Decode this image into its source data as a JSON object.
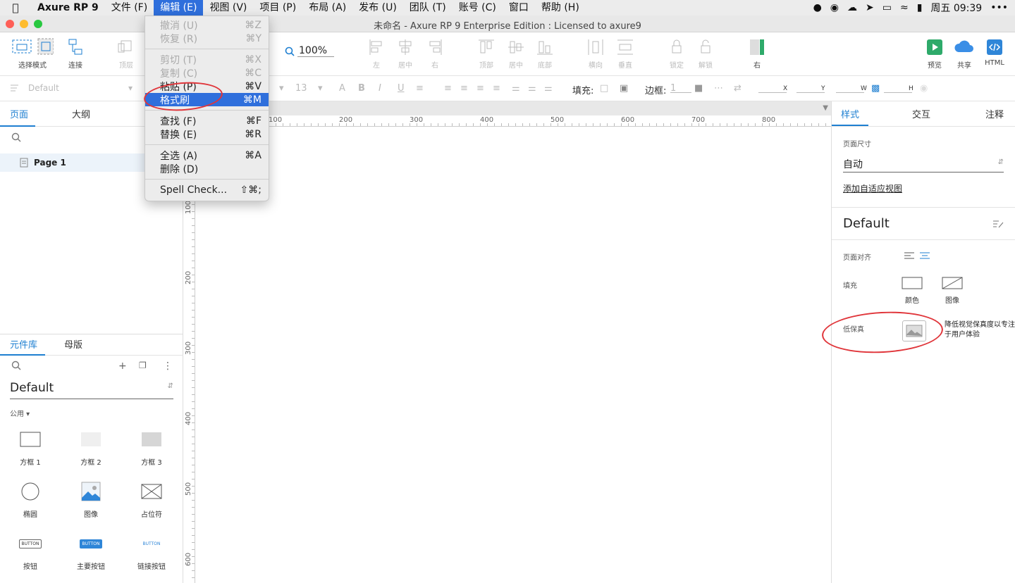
{
  "menubar": {
    "app": "Axure RP 9",
    "items": [
      "文件 (F)",
      "编辑 (E)",
      "视图 (V)",
      "项目 (P)",
      "布局 (A)",
      "发布 (U)",
      "团队 (T)",
      "账号 (C)",
      "窗口",
      "帮助 (H)"
    ],
    "clock": "周五 09:39"
  },
  "window": {
    "title": "未命名 - Axure RP 9 Enterprise Edition : Licensed to axure9"
  },
  "toolbar": {
    "select_mode": "选择模式",
    "connect": "连接",
    "top_layer": "顶层",
    "zoom": "100%",
    "align_left": "左",
    "align_center": "居中",
    "align_right": "右",
    "align_top": "顶部",
    "align_middle": "居中",
    "align_bottom": "底部",
    "distribute_h": "横向",
    "distribute_v": "垂直",
    "lock": "锁定",
    "unlock": "解锁",
    "right": "右",
    "preview": "预览",
    "share": "共享",
    "html": "HTML"
  },
  "formatbar": {
    "style": "Default",
    "font_size": "13",
    "fill_label": "填充:",
    "border_label": "边框:",
    "border_value": "1",
    "x": "X",
    "y": "Y",
    "w": "W",
    "h": "H"
  },
  "left": {
    "tab_pages": "页面",
    "tab_outline": "大纲",
    "page1": "Page 1",
    "tab_library": "元件库",
    "tab_masters": "母版",
    "library": "Default",
    "group": "公用 ▾",
    "widgets": [
      "方框 1",
      "方框 2",
      "方框 3",
      "椭圆",
      "图像",
      "占位符",
      "按钮",
      "主要按钮",
      "链接按钮"
    ],
    "button_text": "BUTTON"
  },
  "ruler": {
    "top": [
      "100",
      "200",
      "300",
      "400",
      "500",
      "600",
      "700",
      "800"
    ],
    "left": [
      "100",
      "200",
      "300",
      "400",
      "500",
      "600"
    ]
  },
  "right": {
    "tab_style": "样式",
    "tab_interaction": "交互",
    "tab_notes": "注释",
    "page_size_label": "页面尺寸",
    "page_size": "自动",
    "add_adaptive": "添加自适应视图",
    "style_name": "Default",
    "page_align": "页面对齐",
    "fill": "填充",
    "fill_color": "颜色",
    "fill_image": "图像",
    "lowfi": "低保真",
    "lowfi_desc": "降低视觉保真度以专注于用户体验"
  },
  "edit_menu": [
    {
      "label": "撤消 (U)",
      "key": "⌘Z",
      "disabled": true
    },
    {
      "label": "恢复 (R)",
      "key": "⌘Y",
      "disabled": true
    },
    {
      "sep": true
    },
    {
      "label": "剪切 (T)",
      "key": "⌘X",
      "disabled": true
    },
    {
      "label": "复制 (C)",
      "key": "⌘C",
      "disabled": true
    },
    {
      "label": "粘贴 (P)",
      "key": "⌘V"
    },
    {
      "label": "格式刷",
      "key": "⌘M",
      "highlighted": true
    },
    {
      "sep": true
    },
    {
      "label": "查找 (F)",
      "key": "⌘F"
    },
    {
      "label": "替换 (E)",
      "key": "⌘R"
    },
    {
      "sep": true
    },
    {
      "label": "全选 (A)",
      "key": "⌘A"
    },
    {
      "label": "删除 (D)",
      "key": ""
    },
    {
      "sep": true
    },
    {
      "label": "Spell Check...",
      "key": "⇧⌘;"
    }
  ],
  "colors": {
    "accent": "#1e7fd1",
    "menu_highlight": "#2f6fdc",
    "annotation": "#e0353a"
  }
}
